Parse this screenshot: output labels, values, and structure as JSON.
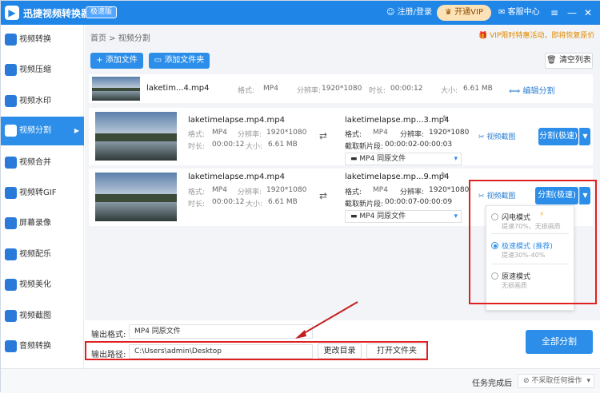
{
  "titlebar": {
    "app_title": "迅捷视频转换器",
    "edition": "极速版",
    "login": "注册/登录",
    "vip": "开通VIP",
    "service": "客服中心",
    "menu_icon": "menu-icon",
    "min_icon": "minimize-icon",
    "close_icon": "close-icon"
  },
  "sidebar": {
    "items": [
      {
        "label": "视频转换",
        "icon": "video-convert-icon"
      },
      {
        "label": "视频压缩",
        "icon": "compress-icon"
      },
      {
        "label": "视频水印",
        "icon": "watermark-icon"
      },
      {
        "label": "视频分割",
        "icon": "split-icon"
      },
      {
        "label": "视频合并",
        "icon": "merge-icon"
      },
      {
        "label": "视频转GIF",
        "icon": "gif-icon"
      },
      {
        "label": "屏幕录像",
        "icon": "record-icon"
      },
      {
        "label": "视频配乐",
        "icon": "music-icon"
      },
      {
        "label": "视频美化",
        "icon": "beautify-icon"
      },
      {
        "label": "视频截图",
        "icon": "screenshot-icon"
      },
      {
        "label": "音频转换",
        "icon": "audio-icon"
      }
    ]
  },
  "main": {
    "breadcrumb": "首页 > 视频分割",
    "promo": "VIP限时特惠活动，即将恢复原价",
    "add_file": "添加文件",
    "add_folder": "添加文件夹",
    "clear_list": "清空列表",
    "source": {
      "name": "laketim...4.mp4",
      "format_label": "格式:",
      "format": "MP4",
      "res_label": "分辨率:",
      "res": "1920*1080",
      "dur_label": "时长:",
      "dur": "00:00:12",
      "size_label": "大小:",
      "size": "6.61 MB",
      "edit": "编辑分割"
    },
    "segments": [
      {
        "name": "laketimelapse.mp4.mp4",
        "format_label": "格式:",
        "format": "MP4",
        "res_label": "分辨率:",
        "res": "1920*1080",
        "dur_label": "时长:",
        "dur": "00:00:12",
        "size_label": "大小:",
        "size": "6.61 MB",
        "out_name": "laketimelapse.mp...3.mp4",
        "out_format_label": "格式:",
        "out_format": "MP4",
        "out_res_label": "分辨率:",
        "out_res": "1920*1080",
        "clip_label": "截取新片段:",
        "clip": "00:00:02-00:00:03",
        "fmt_select": "MP4  同原文件",
        "screenshot": "视频截图",
        "split": "分割(极速)"
      },
      {
        "name": "laketimelapse.mp4.mp4",
        "format_label": "格式:",
        "format": "MP4",
        "res_label": "分辨率:",
        "res": "1920*1080",
        "dur_label": "时长:",
        "dur": "00:00:12",
        "size_label": "大小:",
        "size": "6.61 MB",
        "out_name": "laketimelapse.mp...9.mp4",
        "out_format_label": "格式:",
        "out_format": "MP4",
        "out_res_label": "分辨率:",
        "out_res": "1920*1080",
        "clip_label": "截取新片段:",
        "clip": "00:00:07-00:00:09",
        "fmt_select": "MP4  同原文件",
        "screenshot": "视频截图",
        "split": "分割(极速)"
      }
    ],
    "split_menu": [
      {
        "title": "闪电模式",
        "sub": "提速70%，无损画质",
        "selected": false
      },
      {
        "title": "极速模式 (推荐)",
        "sub": "提速30%-40%",
        "selected": true
      },
      {
        "title": "原速模式",
        "sub": "无损画质",
        "selected": false
      }
    ]
  },
  "bottom": {
    "output_format_label": "输出格式:",
    "output_format": "MP4  同原文件",
    "output_path_label": "输出路径:",
    "output_path": "C:\\Users\\admin\\Desktop",
    "change_dir": "更改目录",
    "open_folder": "打开文件夹",
    "split_all": "全部分割"
  },
  "status": {
    "task_label": "任务完成后",
    "task_option": "不采取任何操作"
  },
  "colors": {
    "accent": "#2c8ee8",
    "annotation_red": "#e02020"
  }
}
